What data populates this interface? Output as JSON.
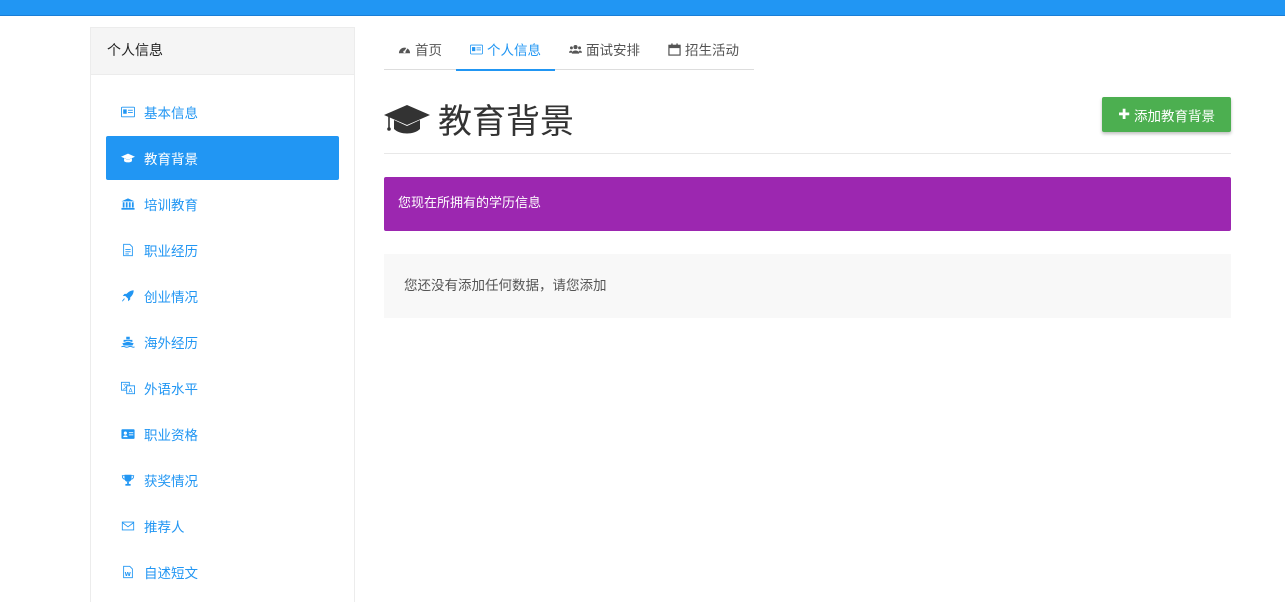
{
  "colors": {
    "primary": "#2196f3",
    "success": "#4caf50",
    "purple": "#9c27b0"
  },
  "sidebar": {
    "title": "个人信息",
    "items": [
      {
        "label": "基本信息",
        "icon": "id-card-icon"
      },
      {
        "label": "教育背景",
        "icon": "graduation-cap-icon",
        "active": true
      },
      {
        "label": "培训教育",
        "icon": "institution-icon"
      },
      {
        "label": "职业经历",
        "icon": "file-text-icon"
      },
      {
        "label": "创业情况",
        "icon": "rocket-icon"
      },
      {
        "label": "海外经历",
        "icon": "ship-icon"
      },
      {
        "label": "外语水平",
        "icon": "language-icon"
      },
      {
        "label": "职业资格",
        "icon": "vcard-icon"
      },
      {
        "label": "获奖情况",
        "icon": "trophy-icon"
      },
      {
        "label": "推荐人",
        "icon": "envelope-icon"
      },
      {
        "label": "自述短文",
        "icon": "word-file-icon"
      }
    ]
  },
  "tabs": [
    {
      "label": "首页",
      "icon": "dashboard-icon"
    },
    {
      "label": "个人信息",
      "icon": "id-card-icon",
      "active": true
    },
    {
      "label": "面试安排",
      "icon": "users-icon"
    },
    {
      "label": "招生活动",
      "icon": "calendar-icon"
    }
  ],
  "page": {
    "title": "教育背景",
    "add_button": "添加教育背景",
    "banner": "您现在所拥有的学历信息",
    "empty_message": "您还没有添加任何数据，请您添加"
  }
}
